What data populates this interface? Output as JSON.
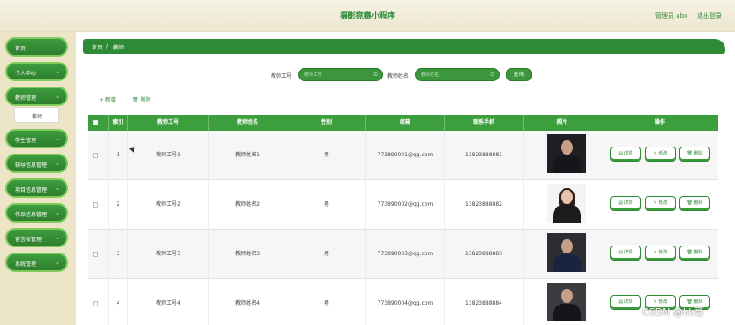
{
  "header": {
    "title": "摄影竞赛小程序",
    "user": "管理员 abo",
    "logout": "退出登录"
  },
  "sidebar": {
    "items": [
      {
        "label": "首页",
        "chevron": ""
      },
      {
        "label": "个人中心",
        "chevron": "⌄"
      },
      {
        "label": "教师管理",
        "chevron": "⌄"
      },
      {
        "label": "学生管理",
        "chevron": "⌄"
      },
      {
        "label": "辅导信息管理",
        "chevron": "⌄"
      },
      {
        "label": "项目信息管理",
        "chevron": "⌄"
      },
      {
        "label": "作品信息管理",
        "chevron": "⌄"
      },
      {
        "label": "留言板管理",
        "chevron": "⌄"
      },
      {
        "label": "系统管理",
        "chevron": "⌄"
      }
    ],
    "submenu": "教师"
  },
  "breadcrumb": {
    "home": "首页",
    "sep": "/",
    "current": "教师"
  },
  "search": {
    "field1_label": "教师工号",
    "field1_placeholder": "教师工号",
    "field2_label": "教师姓名",
    "field2_placeholder": "教师姓名",
    "query": "查询"
  },
  "toolbar": {
    "add": "+ 新增",
    "delete": "🗑 删除"
  },
  "table": {
    "headers": [
      "索引",
      "教师工号",
      "教师姓名",
      "性别",
      "邮箱",
      "联系手机",
      "照片",
      "操作"
    ],
    "rows": [
      {
        "index": "1",
        "id": "教师工号1",
        "name": "教师姓名1",
        "gender": "男",
        "email": "773890001@qq.com",
        "phone": "13823888881"
      },
      {
        "index": "2",
        "id": "教师工号2",
        "name": "教师姓名2",
        "gender": "男",
        "email": "773890002@qq.com",
        "phone": "13823888882"
      },
      {
        "index": "3",
        "id": "教师工号3",
        "name": "教师姓名3",
        "gender": "男",
        "email": "773890003@qq.com",
        "phone": "13823888883"
      },
      {
        "index": "4",
        "id": "教师工号4",
        "name": "教师姓名4",
        "gender": "男",
        "email": "773890004@qq.com",
        "phone": "13823888884"
      }
    ],
    "actions": {
      "detail": "▤ 详情",
      "edit": "✎ 修改",
      "delete": "🗑 删除"
    }
  },
  "watermark": "CSDN @kk哥"
}
